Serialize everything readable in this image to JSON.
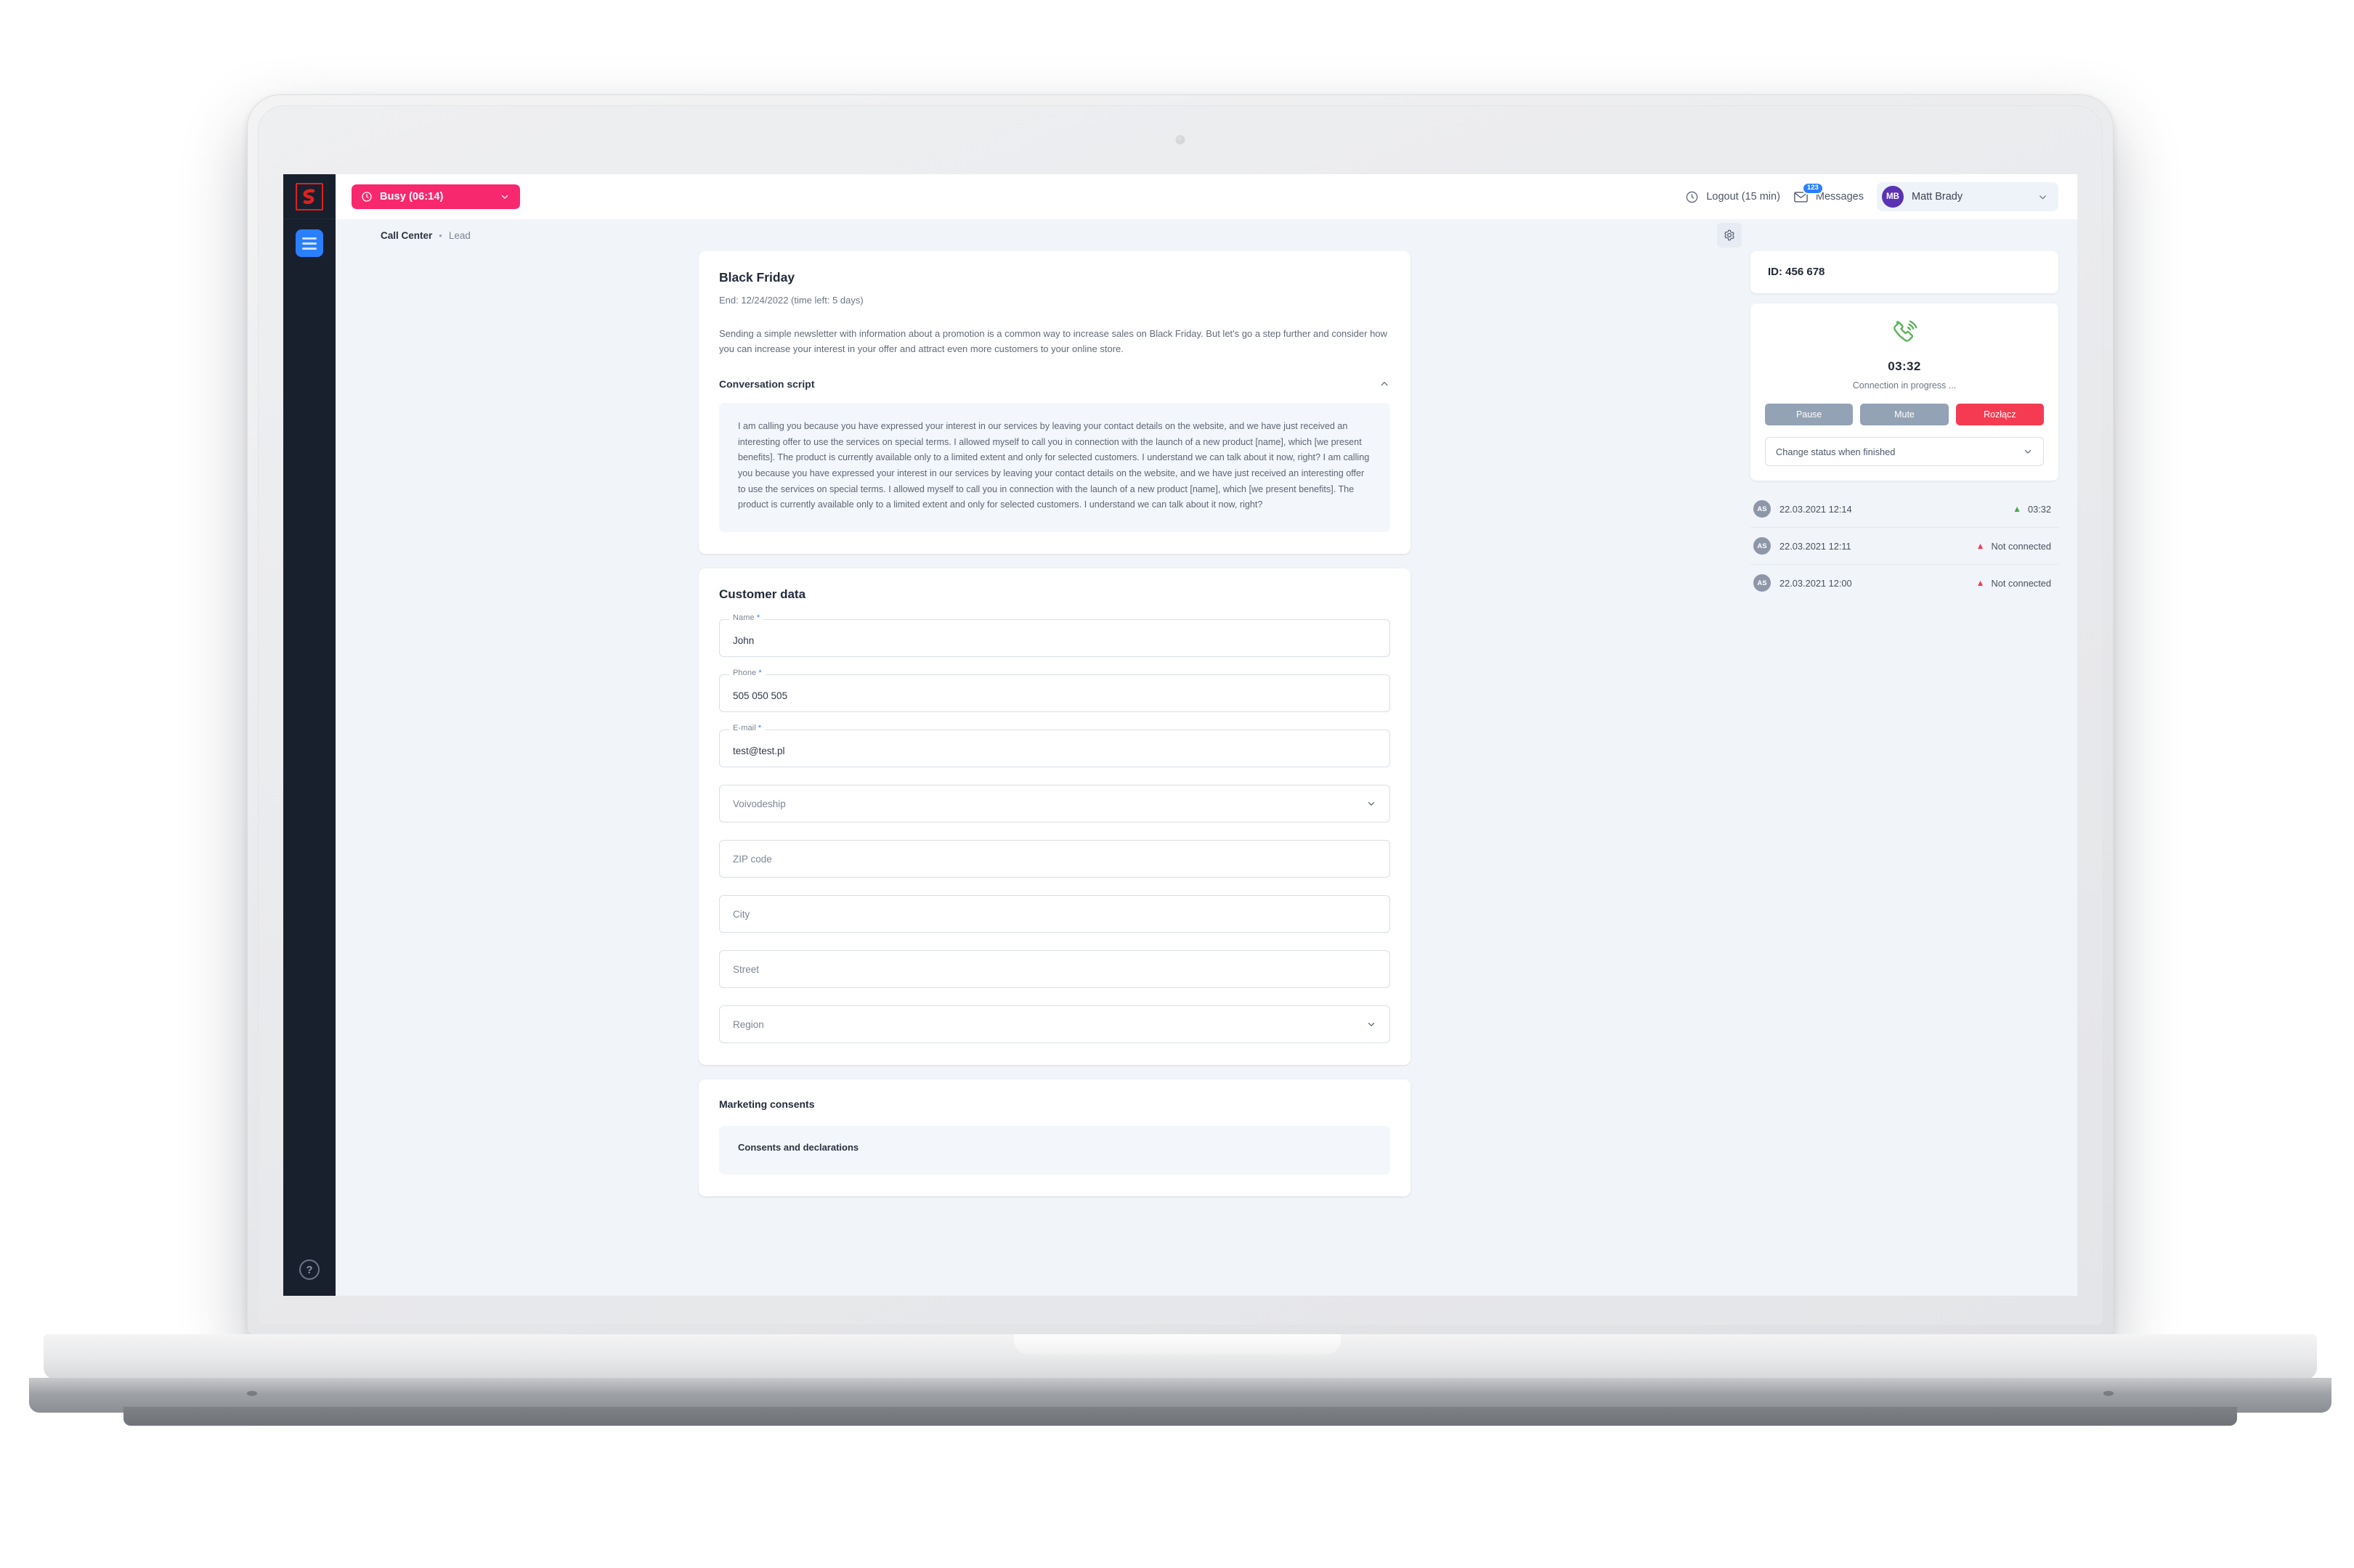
{
  "brand": {
    "logo_name": "company-logo",
    "accent_pink": "#f8286f",
    "accent_blue": "#2a7fff",
    "danger_red": "#f43b52",
    "green": "#5cb85c"
  },
  "topbar": {
    "status": {
      "label": "Busy (06:14)",
      "icon": "clock-icon"
    },
    "logout": {
      "label": "Logout (15 min)",
      "icon": "clock-icon"
    },
    "messages": {
      "label": "Messages",
      "badge": "123",
      "icon": "envelope-icon"
    },
    "user": {
      "initials": "MB",
      "name": "Matt Brady"
    }
  },
  "breadcrumb": {
    "root": "Call Center",
    "separator": "•",
    "current": "Lead"
  },
  "campaign": {
    "title": "Black Friday",
    "end": "End: 12/24/2022 (time left: 5 days)",
    "description": "Sending a simple newsletter with information about a promotion is a common way to increase sales on Black Friday. But let's go a step further and consider how you can increase your interest in your offer and attract even more customers to your online store.",
    "script_header": "Conversation script",
    "script_text": "I am calling you because you have expressed your interest in our services by leaving your contact details on the website, and we have just received an interesting offer to use the services on special terms. I allowed myself to call you in connection with the launch of a new product [name], which [we present benefits]. The product is currently available only to a limited extent and only for selected customers. I understand we can talk about it now, right? I am calling you because you have expressed your interest in our services by leaving your contact details on the website, and we have just received an interesting offer to use the services on special terms. I allowed myself to call you in connection with the launch of a new product [name], which [we present benefits]. The product is currently available only to a limited extent and only for selected customers. I understand we can talk about it now, right?"
  },
  "customer": {
    "section_title": "Customer data",
    "fields": [
      {
        "label": "Name",
        "required": true,
        "value": "John",
        "type": "text"
      },
      {
        "label": "Phone",
        "required": true,
        "value": "505 050 505",
        "type": "text"
      },
      {
        "label": "E-mail",
        "required": true,
        "value": "test@test.pl",
        "type": "text"
      }
    ],
    "selects": [
      {
        "placeholder": "Voivodeship",
        "value": ""
      },
      {
        "placeholder": "Region",
        "value": ""
      }
    ],
    "plain": [
      {
        "placeholder": "ZIP code",
        "value": ""
      },
      {
        "placeholder": "City",
        "value": ""
      },
      {
        "placeholder": "Street",
        "value": ""
      }
    ]
  },
  "consents": {
    "title": "Marketing consents",
    "subtitle": "Consents and declarations"
  },
  "call_panel": {
    "id_label": "ID: 456 678",
    "timer": "03:32",
    "state": "Connection in progress ...",
    "buttons": {
      "pause": "Pause",
      "mute": "Mute",
      "hangup": "Rozłącz"
    },
    "status_select": "Change status when finished"
  },
  "history": [
    {
      "initials": "AS",
      "date": "22.03.2021 12:14",
      "result": "03:32",
      "direction": "up",
      "color": "#49a84c"
    },
    {
      "initials": "AS",
      "date": "22.03.2021 12:11",
      "result": "Not connected",
      "direction": "up",
      "color": "#f43b52"
    },
    {
      "initials": "AS",
      "date": "22.03.2021 12:00",
      "result": "Not connected",
      "direction": "up",
      "color": "#f43b52"
    }
  ]
}
